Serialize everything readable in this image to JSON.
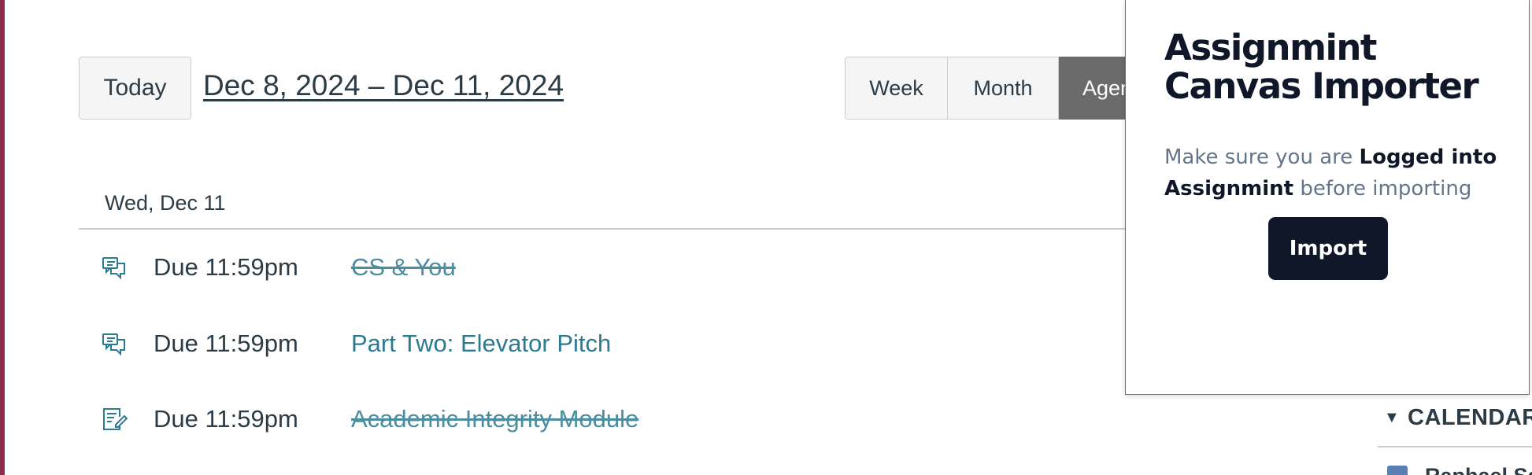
{
  "toolbar": {
    "today_label": "Today",
    "date_range": "Dec 8, 2024 – Dec 11, 2024",
    "views": {
      "week": "Week",
      "month": "Month",
      "agenda": "Agenda"
    }
  },
  "agenda": {
    "day_header": "Wed, Dec 11",
    "items": [
      {
        "icon": "discussion-icon",
        "due": "Due 11:59pm",
        "title": "CS & You",
        "completed": true
      },
      {
        "icon": "discussion-icon",
        "due": "Due 11:59pm",
        "title": "Part Two: Elevator Pitch",
        "completed": false
      },
      {
        "icon": "assignment-icon",
        "due": "Due 11:59pm",
        "title": "Academic Integrity Module",
        "completed": true
      }
    ]
  },
  "sidebar": {
    "calendars_toggle": "▼",
    "calendars_label": "CALENDARS",
    "calendar_name": "Raphael San"
  },
  "popup": {
    "title": "Assignmint Canvas Importer",
    "message_pre": "Make sure you are ",
    "message_bold": "Logged into Assignmint",
    "message_post": " before importing",
    "import_label": "Import"
  },
  "colors": {
    "brand_edge": "#8b2d4f",
    "link": "#2b7a8f",
    "popup_dark": "#0f1729",
    "active_view": "#6b6b6b",
    "calendar_color": "#5b7fb3"
  }
}
